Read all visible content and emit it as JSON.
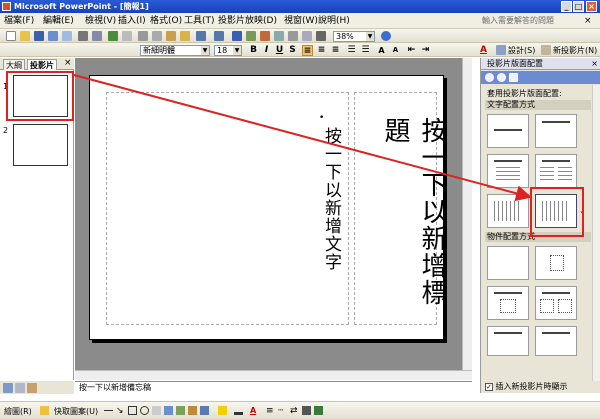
{
  "window": {
    "title": "Microsoft PowerPoint - [簡報1]"
  },
  "menu": {
    "items": [
      "檔案(F)",
      "編輯(E)",
      "檢視(V)",
      "插入(I)",
      "格式(O)",
      "工具(T)",
      "投影片放映(D)",
      "視窗(W)",
      "說明(H)"
    ],
    "help_placeholder": "輸入需要解答的問題"
  },
  "standard_toolbar": {
    "zoom": "38%",
    "font_name": "新細明體",
    "font_size": "18",
    "design_label": "設計(S)",
    "new_slide_label": "新投影片(N)"
  },
  "left_pane": {
    "tabs": [
      "大綱",
      "投影片"
    ],
    "slide_numbers": [
      "1",
      "2"
    ]
  },
  "slide": {
    "title_placeholder": "按一下以新增標題",
    "body_placeholder": "按一下以新增文字",
    "bullet": "•"
  },
  "notes": {
    "placeholder": "按一下以新增備忘稿"
  },
  "task_pane": {
    "title": "投影片版面配置",
    "apply_label": "套用投影片版面配置:",
    "section_text": "文字配置方式",
    "section_content": "物件配置方式",
    "checkbox_label": "插入新投影片時顯示"
  },
  "drawing_toolbar": {
    "draw_label": "繪圖(R)",
    "autoshapes_label": "快取圖案(U)"
  },
  "colors": {
    "titlebar": "#1741b8",
    "annotation": "#dd2222",
    "workspace": "#8b8b8b"
  }
}
